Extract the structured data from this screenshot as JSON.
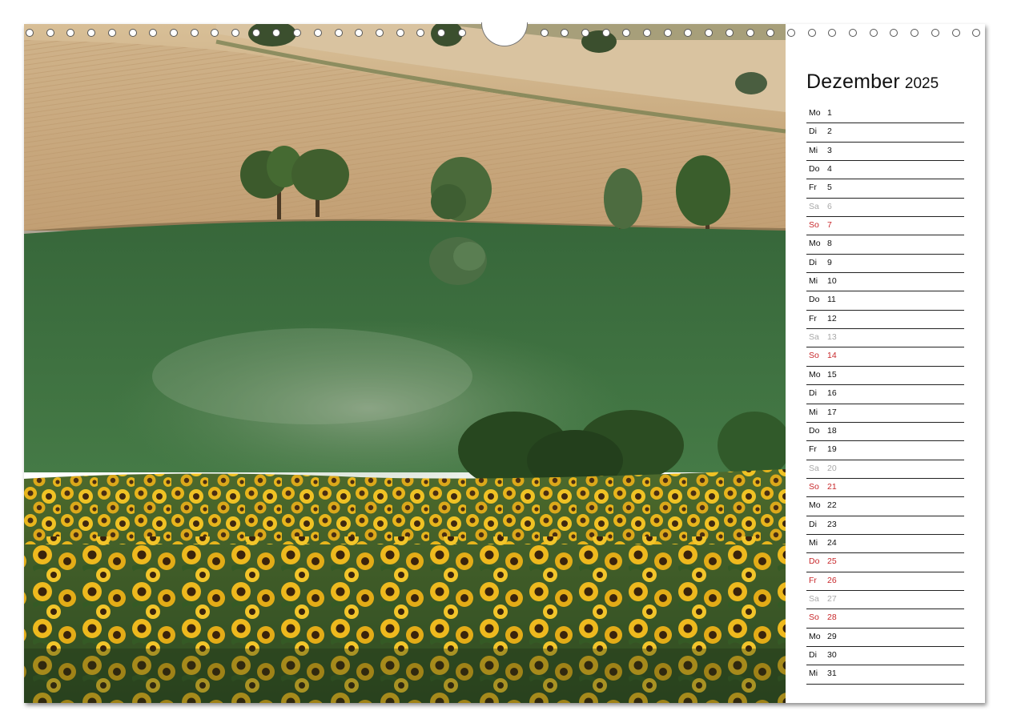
{
  "calendar": {
    "month": "Dezember",
    "year": "2025",
    "days": [
      {
        "wd": "Mo",
        "d": "1",
        "kind": "norm"
      },
      {
        "wd": "Di",
        "d": "2",
        "kind": "norm"
      },
      {
        "wd": "Mi",
        "d": "3",
        "kind": "norm"
      },
      {
        "wd": "Do",
        "d": "4",
        "kind": "norm"
      },
      {
        "wd": "Fr",
        "d": "5",
        "kind": "norm"
      },
      {
        "wd": "Sa",
        "d": "6",
        "kind": "sat"
      },
      {
        "wd": "So",
        "d": "7",
        "kind": "sun"
      },
      {
        "wd": "Mo",
        "d": "8",
        "kind": "norm"
      },
      {
        "wd": "Di",
        "d": "9",
        "kind": "norm"
      },
      {
        "wd": "Mi",
        "d": "10",
        "kind": "norm"
      },
      {
        "wd": "Do",
        "d": "11",
        "kind": "norm"
      },
      {
        "wd": "Fr",
        "d": "12",
        "kind": "norm"
      },
      {
        "wd": "Sa",
        "d": "13",
        "kind": "sat"
      },
      {
        "wd": "So",
        "d": "14",
        "kind": "sun"
      },
      {
        "wd": "Mo",
        "d": "15",
        "kind": "norm"
      },
      {
        "wd": "Di",
        "d": "16",
        "kind": "norm"
      },
      {
        "wd": "Mi",
        "d": "17",
        "kind": "norm"
      },
      {
        "wd": "Do",
        "d": "18",
        "kind": "norm"
      },
      {
        "wd": "Fr",
        "d": "19",
        "kind": "norm"
      },
      {
        "wd": "Sa",
        "d": "20",
        "kind": "sat"
      },
      {
        "wd": "So",
        "d": "21",
        "kind": "sun"
      },
      {
        "wd": "Mo",
        "d": "22",
        "kind": "norm"
      },
      {
        "wd": "Di",
        "d": "23",
        "kind": "norm"
      },
      {
        "wd": "Mi",
        "d": "24",
        "kind": "norm"
      },
      {
        "wd": "Do",
        "d": "25",
        "kind": "sun"
      },
      {
        "wd": "Fr",
        "d": "26",
        "kind": "sun"
      },
      {
        "wd": "Sa",
        "d": "27",
        "kind": "sat"
      },
      {
        "wd": "So",
        "d": "28",
        "kind": "sun"
      },
      {
        "wd": "Mo",
        "d": "29",
        "kind": "norm"
      },
      {
        "wd": "Di",
        "d": "30",
        "kind": "norm"
      },
      {
        "wd": "Mi",
        "d": "31",
        "kind": "norm"
      }
    ]
  },
  "colors": {
    "sunday_holiday": "#c8282b",
    "saturday": "#a8a8a8",
    "weekday": "#111111",
    "wheat_field": "#c7a77c",
    "grass_field": "#3f7040",
    "sunflower": "#e6b21a"
  },
  "photo": {
    "icon": "landscape-photo"
  }
}
